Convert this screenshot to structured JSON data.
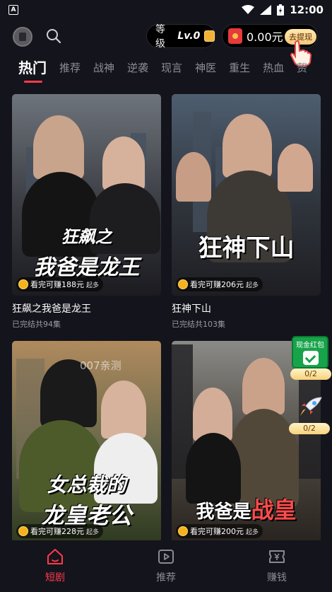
{
  "status_bar": {
    "app_icon_letter": "A",
    "time": "12:00"
  },
  "header": {
    "level_label": "等级",
    "level_value": "Lv.0",
    "balance": "0.00元",
    "withdraw_label": "去提现"
  },
  "tabs": [
    "热门",
    "推荐",
    "战神",
    "逆袭",
    "现言",
    "神医",
    "重生",
    "热血",
    "赘"
  ],
  "cards": [
    {
      "poster_title_line1": "狂飙之",
      "poster_title_line2": "我爸是龙王",
      "reward": "看完可赚188元",
      "reward_more": "起多",
      "title": "狂飙之我爸是龙王",
      "status": "已完结共94集",
      "colors": {
        "bg_top": "#6e747c",
        "bg_bottom": "#1b1b20"
      }
    },
    {
      "poster_title_line1": "狂神下山",
      "poster_title_line2": "",
      "reward": "看完可赚206元",
      "reward_more": "起多",
      "title": "狂神下山",
      "status": "已完结共103集",
      "colors": {
        "bg_top": "#4e5e70",
        "bg_bottom": "#1e1e22"
      }
    },
    {
      "poster_title_line1": "女总裁的",
      "poster_title_line2": "龙皇老公",
      "watermark": "007亲测",
      "reward": "看完可赚228元",
      "reward_more": "起多",
      "title": "",
      "status": "",
      "colors": {
        "bg_top": "#b08a5e",
        "bg_bottom": "#2e3a20"
      }
    },
    {
      "poster_title_line1": "我爸是",
      "poster_title_line2": "战皇",
      "reward": "看完可赚200元",
      "reward_more": "起多",
      "title": "",
      "status": "",
      "colors": {
        "bg_top": "#8a8a86",
        "bg_bottom": "#2a2420"
      }
    }
  ],
  "widgets": {
    "cash_label": "现金红包",
    "cash_count": "0/2",
    "rocket_count": "0/2"
  },
  "bottom_nav": {
    "items": [
      "短剧",
      "推荐",
      "赚钱"
    ],
    "active_color": "#ff3b4a"
  }
}
